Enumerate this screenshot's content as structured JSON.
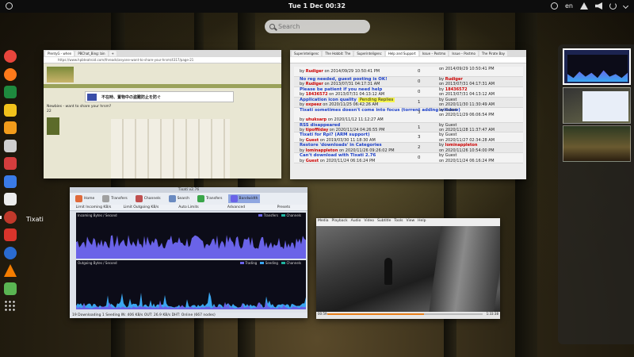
{
  "topbar": {
    "clock": "Tue 1 Dec  00:32",
    "lang": "en"
  },
  "search": {
    "placeholder": "Search"
  },
  "dash": {
    "running_label": "Tixati",
    "apps": [
      {
        "name": "chrome",
        "color": "#e8453c"
      },
      {
        "name": "firefox",
        "color": "#ff7a1a"
      },
      {
        "name": "libreoffice",
        "color": "#1e8a3e"
      },
      {
        "name": "pinwheel",
        "color": "#f2c21b"
      },
      {
        "name": "slides",
        "color": "#f29c1b"
      },
      {
        "name": "files",
        "color": "#cfcfcf"
      },
      {
        "name": "settings",
        "color": "#d43d3d"
      },
      {
        "name": "docs",
        "color": "#3a7be8"
      },
      {
        "name": "terminal",
        "color": "#ececec"
      },
      {
        "name": "tixati",
        "color": "#c0392b"
      },
      {
        "name": "pinwheel2",
        "color": "#d9342b"
      },
      {
        "name": "thunderbird",
        "color": "#2a6bd1"
      },
      {
        "name": "vlc",
        "color": "#f57d00"
      },
      {
        "name": "trash",
        "color": "#5ab552"
      },
      {
        "name": "show-apps",
        "color": "#dddddd"
      }
    ]
  },
  "browser": {
    "tabs": [
      "PlentyG - when",
      "PBChat_Bing: bin",
      "+"
    ],
    "url": "https://www.hpbteatroid.com/threads/anyone-want-to-share-your-hrsm/4317/page-21",
    "japanese": "不在時、置物中の盗難防止を防ぐ",
    "caption1": "Newbies - want to share your hrsm?",
    "caption2": "22"
  },
  "forum": {
    "tabs": [
      "Superinteligenc",
      "The Hobbit: The",
      "Superinteligenc",
      "Help and Support",
      "Issue – Postmo",
      "Issue – Postmo",
      "The Pirate Bay"
    ],
    "rows": [
      {
        "title": "",
        "by": "Rudiger",
        "on": "on 2014/09/29 10:50:41 PM",
        "n": "0",
        "l1": "on 2014/09/29 10:50:41 PM",
        "l1b": "",
        "l2": ""
      },
      {
        "title": "No reg needed, guest posting is OK!",
        "by": "Rudiger",
        "on": "on 2013/07/31 04:17:31 AM",
        "n": "0",
        "l1": "by ",
        "l1b": "Rudiger",
        "l2": "on 2013/07/31 04:17:31 AM"
      },
      {
        "title": "Please be patient if you need help",
        "by": "18436572",
        "on": "on 2013/07/31 04:13:12 AM",
        "n": "0",
        "l1": "by ",
        "l1b": "18436572",
        "l2": "on 2013/07/31 04:13:12 AM"
      },
      {
        "title": "Application icon quality",
        "tag": "Pending Replies",
        "by": "oxpeez",
        "on": "on 2020/11/25 06:42:26 AM",
        "n": "1",
        "l1": "by Guest",
        "l1b": "",
        "l2": "on 2020/11/30 11:30:49 AM"
      },
      {
        "title": "Tixati sometimes doesn't come into focus (torrent adding window)",
        "by": "uhuksarp",
        "on": "on 2020/11/12 11:12:27 AM",
        "n": "3",
        "l1": "by Guest",
        "l1b": "",
        "l2": "on 2020/11/29 06:06:54 PM"
      },
      {
        "title": "RSS disappeared",
        "by": "tipoffiiday",
        "on": "on 2020/11/24 04:26:55 PM",
        "n": "1",
        "l1": "by Guest",
        "l1b": "",
        "l2": "on 2020/11/28 11:37:47 AM"
      },
      {
        "title": "Tixati for Rpi? (ARM support)",
        "by": "Guest",
        "on": "on 2019/03/30 11:18:30 AM",
        "n": "3",
        "l1": "by Guest",
        "l1b": "",
        "l2": "on 2020/11/27 02:34:28 AM"
      },
      {
        "title": "Restore 'downloads' in Categories",
        "by": "lominappleton",
        "on": "on 2020/11/26 09:26:02 PM",
        "n": "2",
        "l1": "by ",
        "l1b": "lominappleton",
        "l2": "on 2020/11/26 10:54:00 PM"
      },
      {
        "title": "Can't download with Tixati 2.76",
        "by": "Guest",
        "on": "on 2020/11/24 06:16:24 PM",
        "n": "0",
        "l1": "by Guest",
        "l1b": "",
        "l2": "on 2020/11/24 06:16:24 PM"
      }
    ]
  },
  "tixati": {
    "title": "Tixati v2.76",
    "tools": [
      "Home",
      "Transfers",
      "Channels",
      "Search",
      "Transfers",
      "Bandwidth"
    ],
    "sub": [
      "Limit Incoming KB/s",
      "Limit Outgoing KB/s",
      "Auto Limits",
      "Advanced",
      "Presets"
    ],
    "graph_in_label": "Incoming Bytes / Second",
    "graph_out_label": "Outgoing Bytes / Second",
    "legend_in": [
      "Transfers",
      "Channels"
    ],
    "legend_out": [
      "Trading",
      "Seeding",
      "Channels"
    ],
    "status": "19 Downloading   1 Seeding    IN: 406 KB/s    OUT: 26.9 KB/s    DHT: Online (667 nodes)",
    "colors": {
      "in": "#6a63e8",
      "trading": "#6a63e8",
      "seeding": "#3aa6f0"
    }
  },
  "vlc": {
    "menu": [
      "Media",
      "Playback",
      "Audio",
      "Video",
      "Subtitle",
      "Tools",
      "View",
      "Help"
    ],
    "time_left": "00:59",
    "time_right": "1:33:38",
    "progress": 0.62,
    "accent": "#e87f1a"
  }
}
